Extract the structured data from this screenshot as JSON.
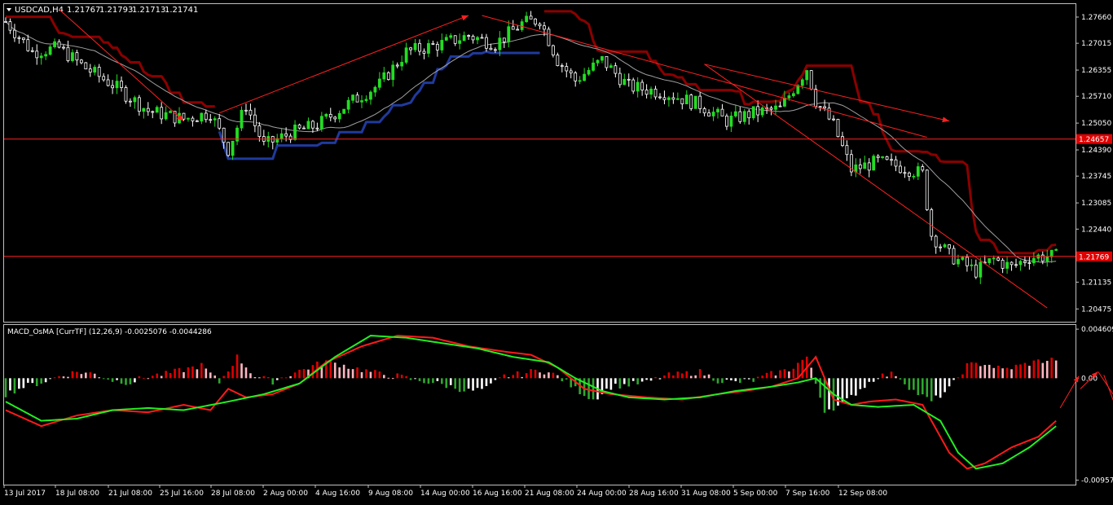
{
  "colors": {
    "background": "#000000",
    "frame": "#c0c0c0",
    "bull_candle": "#22dd22",
    "bear_candle": "#ffffff",
    "price_line": "#ff2020",
    "label_box": "#e00000",
    "supertrend_dark": "#8b0000",
    "supertrend_blue": "#1f3a9e",
    "ma_grey": "#a0a0a0",
    "macd_red": "#ff1a1a",
    "macd_green": "#22ee22",
    "hist_red": "#e00000",
    "hist_pink": "#ffb6c1",
    "hist_green": "#2ea82e",
    "hist_white": "#ffffff"
  },
  "chart_data": [
    {
      "type": "candlestick",
      "header": {
        "symbol": "USDCAD,H4",
        "open": "1.21767",
        "high": "1.21793",
        "low": "1.21713",
        "close": "1.21741"
      },
      "ylim": [
        1.2016,
        1.2798
      ],
      "y_ticks": [
        "1.27660",
        "1.27015",
        "1.26355",
        "1.25710",
        "1.25050",
        "1.24390",
        "1.23745",
        "1.23085",
        "1.22440",
        "1.21135",
        "1.20475"
      ],
      "x_ticks": [
        "13 Jul 2017",
        "18 Jul 08:00",
        "21 Jul 08:00",
        "25 Jul 16:00",
        "28 Jul 08:00",
        "2 Aug 00:00",
        "4 Aug 16:00",
        "9 Aug 08:00",
        "14 Aug 00:00",
        "16 Aug 16:00",
        "21 Aug 08:00",
        "24 Aug 00:00",
        "28 Aug 16:00",
        "31 Aug 08:00",
        "5 Sep 00:00",
        "7 Sep 16:00",
        "12 Sep 08:00"
      ],
      "horizontal_lines": [
        {
          "price": 1.24657,
          "label": "1.24657"
        },
        {
          "price": 1.21769,
          "label": "1.21769"
        }
      ],
      "close_path": [
        [
          0,
          1.2755
        ],
        [
          6,
          1.268
        ],
        [
          12,
          1.269
        ],
        [
          18,
          1.264
        ],
        [
          24,
          1.26
        ],
        [
          32,
          1.2535
        ],
        [
          40,
          1.2515
        ],
        [
          46,
          1.253
        ],
        [
          50,
          1.244
        ],
        [
          54,
          1.255
        ],
        [
          58,
          1.245
        ],
        [
          64,
          1.248
        ],
        [
          70,
          1.25
        ],
        [
          78,
          1.256
        ],
        [
          84,
          1.26
        ],
        [
          90,
          1.268
        ],
        [
          98,
          1.27
        ],
        [
          104,
          1.272
        ],
        [
          110,
          1.27
        ],
        [
          116,
          1.275
        ],
        [
          120,
          1.276
        ],
        [
          124,
          1.266
        ],
        [
          128,
          1.261
        ],
        [
          134,
          1.266
        ],
        [
          140,
          1.2595
        ],
        [
          148,
          1.258
        ],
        [
          156,
          1.255
        ],
        [
          162,
          1.251
        ],
        [
          168,
          1.253
        ],
        [
          174,
          1.254
        ],
        [
          180,
          1.264
        ],
        [
          182,
          1.256
        ],
        [
          186,
          1.25
        ],
        [
          190,
          1.239
        ],
        [
          196,
          1.241
        ],
        [
          202,
          1.2395
        ],
        [
          206,
          1.238
        ],
        [
          208,
          1.223
        ],
        [
          212,
          1.218
        ],
        [
          218,
          1.214
        ],
        [
          222,
          1.217
        ],
        [
          226,
          1.215
        ],
        [
          230,
          1.2175
        ],
        [
          234,
          1.2177
        ]
      ]
    },
    {
      "type": "macd_osma",
      "title": "MACD_OsMA [CurrTF] (12,26,9) -0.0025076 -0.0044286",
      "ylim": [
        -0.01,
        0.005
      ],
      "y_ticks": [
        "0.004609",
        "0.00",
        "-0.009572"
      ],
      "macd": [
        [
          0,
          -0.003
        ],
        [
          8,
          -0.0045
        ],
        [
          16,
          -0.0035
        ],
        [
          24,
          -0.003
        ],
        [
          32,
          -0.0032
        ],
        [
          40,
          -0.0025
        ],
        [
          46,
          -0.003
        ],
        [
          50,
          -0.001
        ],
        [
          54,
          -0.0018
        ],
        [
          60,
          -0.0015
        ],
        [
          66,
          -0.0005
        ],
        [
          72,
          0.0015
        ],
        [
          80,
          0.003
        ],
        [
          88,
          0.004
        ],
        [
          96,
          0.0038
        ],
        [
          104,
          0.003
        ],
        [
          112,
          0.0025
        ],
        [
          118,
          0.0022
        ],
        [
          124,
          0.001
        ],
        [
          130,
          -0.001
        ],
        [
          136,
          -0.0015
        ],
        [
          144,
          -0.0018
        ],
        [
          152,
          -0.002
        ],
        [
          160,
          -0.0015
        ],
        [
          166,
          -0.0012
        ],
        [
          172,
          -0.0008
        ],
        [
          178,
          0.0
        ],
        [
          182,
          0.002
        ],
        [
          186,
          -0.002
        ],
        [
          190,
          -0.0025
        ],
        [
          194,
          -0.0022
        ],
        [
          200,
          -0.002
        ],
        [
          206,
          -0.0025
        ],
        [
          212,
          -0.007
        ],
        [
          216,
          -0.0085
        ],
        [
          220,
          -0.008
        ],
        [
          226,
          -0.0065
        ],
        [
          232,
          -0.0055
        ],
        [
          236,
          -0.004
        ]
      ],
      "signal": [
        [
          0,
          -0.0022
        ],
        [
          8,
          -0.004
        ],
        [
          16,
          -0.0038
        ],
        [
          24,
          -0.003
        ],
        [
          32,
          -0.0028
        ],
        [
          40,
          -0.003
        ],
        [
          50,
          -0.0022
        ],
        [
          58,
          -0.0015
        ],
        [
          66,
          -0.0005
        ],
        [
          74,
          0.002
        ],
        [
          82,
          0.004
        ],
        [
          90,
          0.0038
        ],
        [
          98,
          0.0033
        ],
        [
          106,
          0.0028
        ],
        [
          114,
          0.002
        ],
        [
          122,
          0.0015
        ],
        [
          128,
          0.0
        ],
        [
          134,
          -0.0012
        ],
        [
          140,
          -0.0018
        ],
        [
          148,
          -0.002
        ],
        [
          156,
          -0.0018
        ],
        [
          164,
          -0.0012
        ],
        [
          172,
          -0.0008
        ],
        [
          178,
          -0.0004
        ],
        [
          182,
          0.0
        ],
        [
          186,
          -0.0015
        ],
        [
          190,
          -0.0025
        ],
        [
          196,
          -0.0027
        ],
        [
          204,
          -0.0025
        ],
        [
          210,
          -0.004
        ],
        [
          214,
          -0.007
        ],
        [
          218,
          -0.0085
        ],
        [
          224,
          -0.008
        ],
        [
          230,
          -0.0065
        ],
        [
          236,
          -0.0045
        ]
      ],
      "histogram": [
        [
          0,
          -0.0015
        ],
        [
          4,
          -0.0008
        ],
        [
          8,
          -0.0004
        ],
        [
          12,
          0.0002
        ],
        [
          16,
          0.0006
        ],
        [
          20,
          0.0004
        ],
        [
          24,
          -0.0002
        ],
        [
          28,
          -0.0004
        ],
        [
          32,
          0.0002
        ],
        [
          36,
          0.0004
        ],
        [
          40,
          0.0008
        ],
        [
          44,
          0.0012
        ],
        [
          48,
          -0.0004
        ],
        [
          52,
          0.002
        ],
        [
          56,
          0.0002
        ],
        [
          60,
          -0.0003
        ],
        [
          64,
          0.0004
        ],
        [
          68,
          0.001
        ],
        [
          72,
          0.0016
        ],
        [
          76,
          0.0012
        ],
        [
          80,
          0.0008
        ],
        [
          84,
          0.0004
        ],
        [
          88,
          0.0002
        ],
        [
          92,
          -0.0002
        ],
        [
          96,
          -0.0004
        ],
        [
          100,
          -0.0008
        ],
        [
          104,
          -0.0012
        ],
        [
          108,
          -0.001
        ],
        [
          112,
          0.0002
        ],
        [
          116,
          0.0004
        ],
        [
          120,
          0.0008
        ],
        [
          124,
          0.0002
        ],
        [
          128,
          -0.001
        ],
        [
          132,
          -0.002
        ],
        [
          136,
          -0.0008
        ],
        [
          140,
          -0.0006
        ],
        [
          144,
          -0.0004
        ],
        [
          148,
          0.0002
        ],
        [
          152,
          0.0004
        ],
        [
          156,
          0.0006
        ],
        [
          160,
          -0.0002
        ],
        [
          164,
          -0.0004
        ],
        [
          168,
          -0.0002
        ],
        [
          172,
          0.0004
        ],
        [
          176,
          0.0008
        ],
        [
          180,
          0.002
        ],
        [
          184,
          -0.003
        ],
        [
          188,
          -0.0025
        ],
        [
          192,
          -0.001
        ],
        [
          196,
          0.0002
        ],
        [
          200,
          0.0004
        ],
        [
          204,
          -0.0012
        ],
        [
          208,
          -0.0022
        ],
        [
          212,
          -0.001
        ],
        [
          216,
          0.0012
        ],
        [
          220,
          0.0014
        ],
        [
          224,
          0.0008
        ],
        [
          228,
          0.0012
        ],
        [
          232,
          0.0016
        ],
        [
          236,
          0.0018
        ]
      ]
    }
  ]
}
